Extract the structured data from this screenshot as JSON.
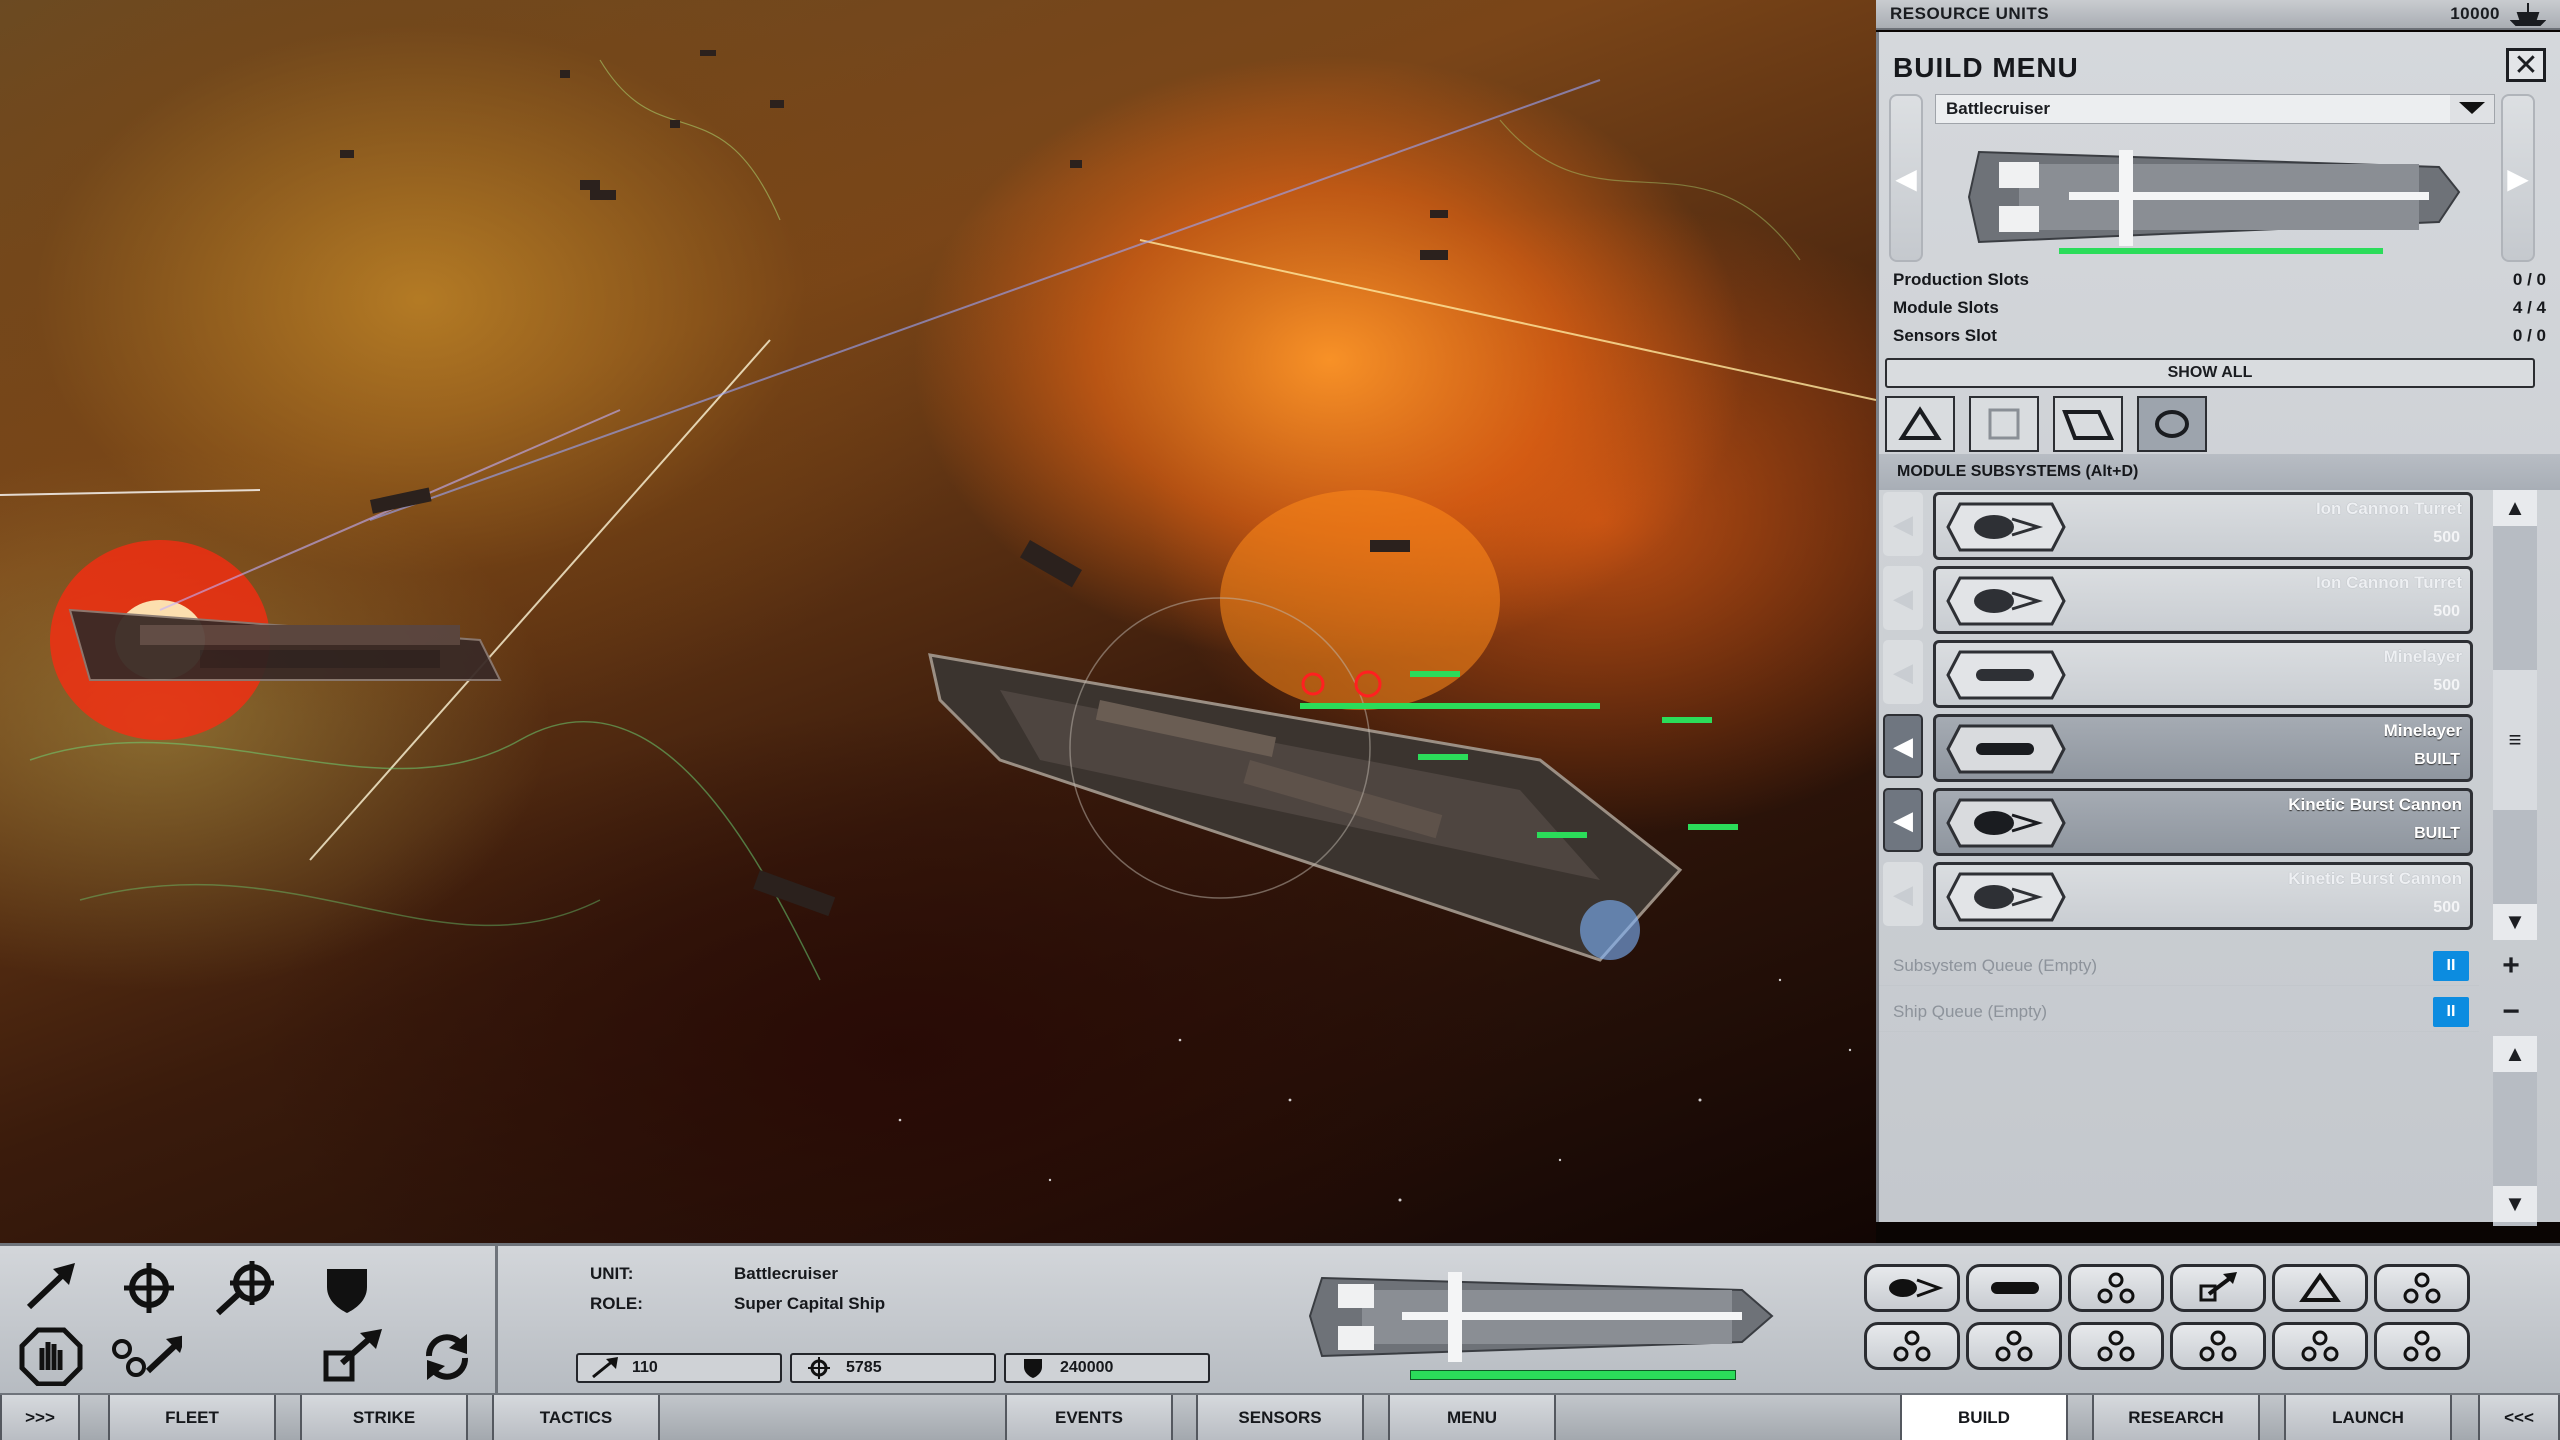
{
  "resource_bar": {
    "label": "RESOURCE UNITS",
    "value": "10000",
    "icon": "resource-ship-icon"
  },
  "build_menu": {
    "title": "BUILD MENU",
    "close_icon": "close-icon",
    "selected_ship": "Battlecruiser",
    "stats": [
      {
        "label": "Production Slots",
        "value": "0 / 0"
      },
      {
        "label": "Module Slots",
        "value": "4 / 4"
      },
      {
        "label": "Sensors Slot",
        "value": "0 / 0"
      }
    ],
    "build_progress": 1.0,
    "show_all_label": "SHOW ALL",
    "filters": [
      "triangle-filter-icon",
      "square-filter-icon",
      "parallelogram-filter-icon",
      "circle-filter-icon"
    ],
    "selected_filter": 3,
    "subsystems_header": "MODULE SUBSYSTEMS (Alt+D)",
    "modules": [
      {
        "name": "Ion Cannon Turret",
        "status": "500",
        "icon": "ion-cannon-icon",
        "built": false
      },
      {
        "name": "Ion Cannon Turret",
        "status": "500",
        "icon": "ion-cannon-icon",
        "built": false
      },
      {
        "name": "Minelayer",
        "status": "500",
        "icon": "minelayer-icon",
        "built": false
      },
      {
        "name": "Minelayer",
        "status": "BUILT",
        "icon": "minelayer-icon",
        "built": true
      },
      {
        "name": "Kinetic Burst Cannon",
        "status": "BUILT",
        "icon": "kinetic-cannon-icon",
        "built": true
      },
      {
        "name": "Kinetic Burst Cannon",
        "status": "500",
        "icon": "kinetic-cannon-icon",
        "built": false
      }
    ],
    "subsystem_queue": "Subsystem Queue (Empty)",
    "ship_queue": "Ship Queue (Empty)",
    "pause_label": "II",
    "plus_label": "+",
    "minus_label": "−"
  },
  "unit_info": {
    "unit_label": "UNIT:",
    "unit_value": "Battlecruiser",
    "role_label": "ROLE:",
    "role_value": "Super Capital Ship",
    "speed": "110",
    "firepower": "5785",
    "armor": "240000",
    "health": 1.0
  },
  "orders": [
    "move-icon",
    "attack-icon",
    "attack-move-icon",
    "defend-icon",
    "stop-icon",
    "guard-icon",
    "dock-icon",
    "retire-icon"
  ],
  "module_icons": [
    "ion-cannon-icon",
    "minelayer-icon",
    "empty-slot-icon",
    "launch-icon",
    "triangle-icon",
    "empty-slot-icon",
    "empty-slot-icon",
    "empty-slot-icon",
    "empty-slot-icon",
    "empty-slot-icon",
    "empty-slot-icon",
    "empty-slot-icon"
  ],
  "tabs": {
    "expand": ">>>",
    "fleet": "FLEET",
    "strike": "STRIKE",
    "tactics": "TACTICS",
    "events": "EVENTS",
    "sensors": "SENSORS",
    "menu": "MENU",
    "build": "BUILD",
    "research": "RESEARCH",
    "launch": "LAUNCH",
    "collapse": "<<<"
  },
  "colors": {
    "accent_blue": "#0c8ce0",
    "health_green": "#2bdc5a",
    "panel_grey": "#c9ccd0"
  }
}
